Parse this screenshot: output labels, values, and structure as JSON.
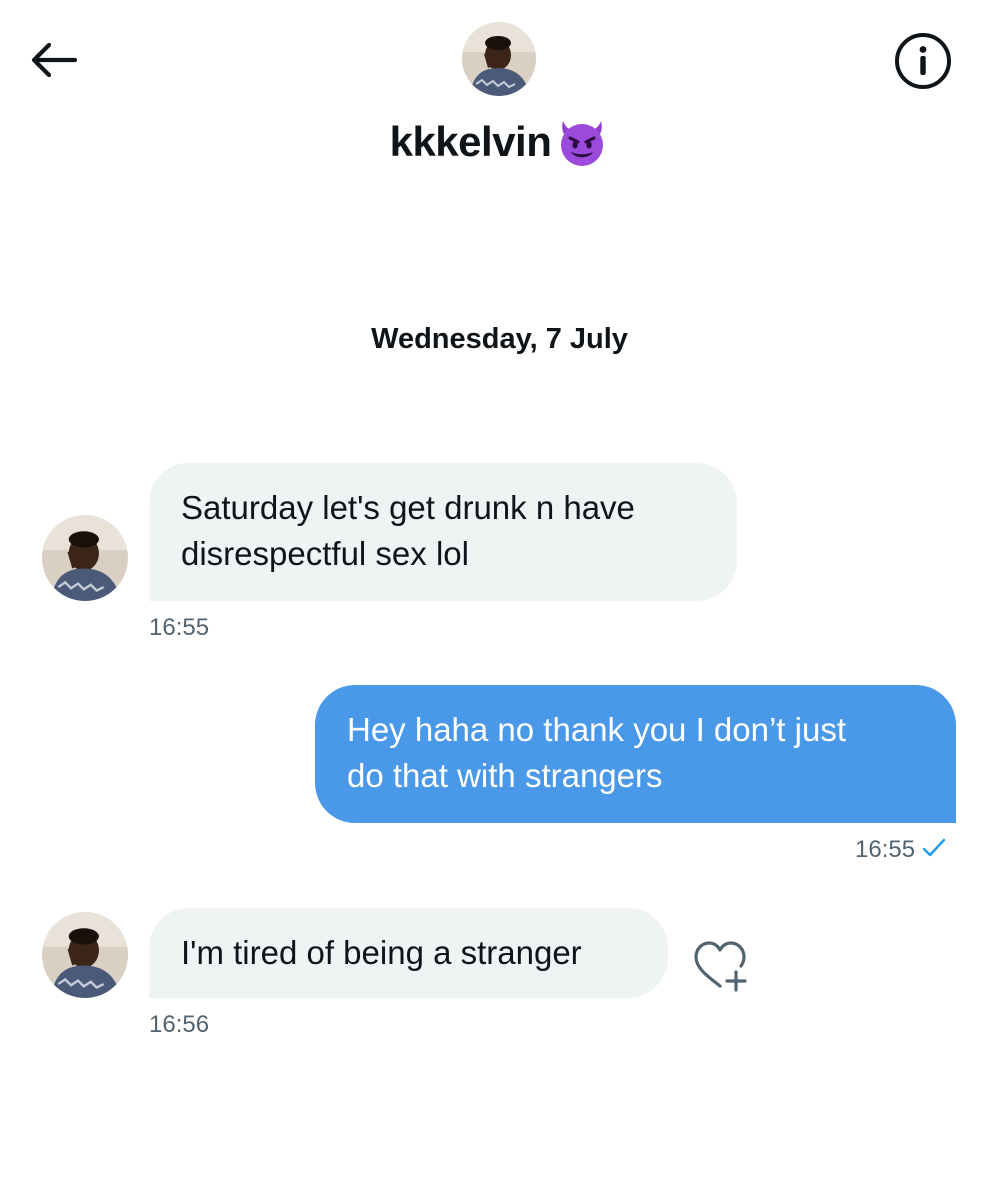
{
  "header": {
    "username": "kkkelvin",
    "name_emoji": "smiling-devil-icon",
    "back_icon": "back-arrow-icon",
    "info_icon": "info-icon"
  },
  "conversation": {
    "date_separator": "Wednesday, 7 July",
    "messages": [
      {
        "direction": "incoming",
        "lines": [
          "Saturday let's get drunk n have",
          "disrespectful sex lol"
        ],
        "time": "16:55"
      },
      {
        "direction": "outgoing",
        "lines": [
          "Hey haha no thank you I don’t just",
          "do that with strangers"
        ],
        "time": "16:55",
        "status_icon": "sent-check-icon"
      },
      {
        "direction": "incoming",
        "lines": [
          "I'm tired of being a stranger"
        ],
        "time": "16:56",
        "reaction_icon": "heart-add-icon"
      }
    ]
  },
  "colors": {
    "outgoing_bubble": "#4a99e9",
    "incoming_bubble": "#eff3f4",
    "timestamp": "#536471",
    "check": "#1d9bf0"
  }
}
